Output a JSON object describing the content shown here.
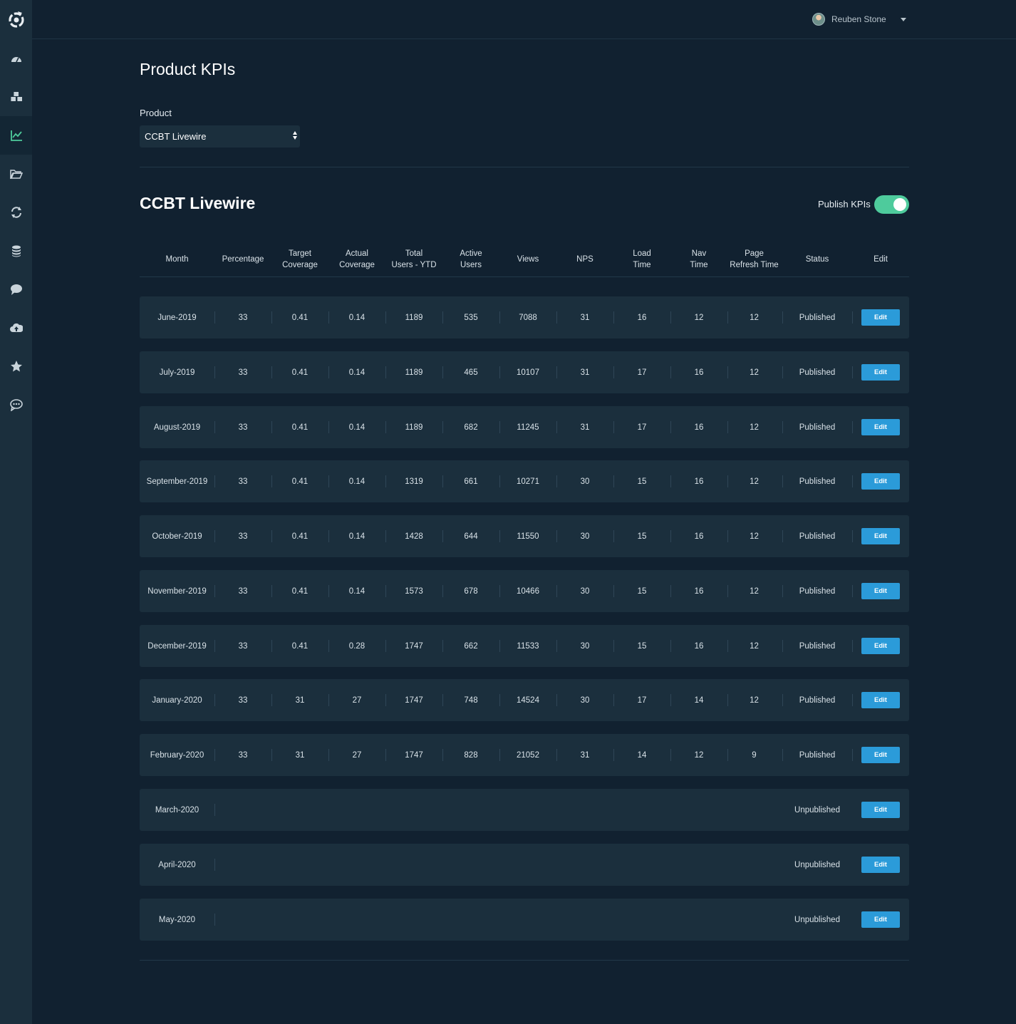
{
  "header": {
    "user_name": "Reuben Stone"
  },
  "sidebar": {
    "items": [
      {
        "icon": "dashboard-icon"
      },
      {
        "icon": "cubes-icon"
      },
      {
        "icon": "line-chart-icon",
        "active": true
      },
      {
        "icon": "folder-open-icon"
      },
      {
        "icon": "refresh-icon"
      },
      {
        "icon": "database-icon"
      },
      {
        "icon": "comment-icon"
      },
      {
        "icon": "cloud-upload-icon"
      },
      {
        "icon": "star-icon"
      },
      {
        "icon": "chat-dots-icon"
      }
    ]
  },
  "page": {
    "title": "Product KPIs",
    "product_label": "Product",
    "product_value": "CCBT Livewire"
  },
  "section": {
    "title": "CCBT Livewire",
    "publish_label": "Publish KPIs",
    "publish_on": true
  },
  "colors": {
    "accent_green": "#4ecb9c",
    "edit_blue": "#2b9bd9",
    "background": "#112130",
    "row": "#1b2f3d"
  },
  "table": {
    "columns": [
      [
        "Month"
      ],
      [
        "Percentage"
      ],
      [
        "Target",
        "Coverage"
      ],
      [
        "Actual",
        "Coverage"
      ],
      [
        "Total",
        "Users - YTD"
      ],
      [
        "Active",
        "Users"
      ],
      [
        "Views"
      ],
      [
        "NPS"
      ],
      [
        "Load",
        "Time"
      ],
      [
        "Nav",
        "Time"
      ],
      [
        "Page",
        "Refresh Time"
      ],
      [
        "Status"
      ],
      [
        "Edit"
      ]
    ],
    "edit_label": "Edit",
    "rows": [
      {
        "month": "June-2019",
        "values": [
          "33",
          "0.41",
          "0.14",
          "1189",
          "535",
          "7088",
          "31",
          "16",
          "12",
          "12"
        ],
        "status": "Published"
      },
      {
        "month": "July-2019",
        "values": [
          "33",
          "0.41",
          "0.14",
          "1189",
          "465",
          "10107",
          "31",
          "17",
          "16",
          "12"
        ],
        "status": "Published"
      },
      {
        "month": "August-2019",
        "values": [
          "33",
          "0.41",
          "0.14",
          "1189",
          "682",
          "11245",
          "31",
          "17",
          "16",
          "12"
        ],
        "status": "Published"
      },
      {
        "month": "September-2019",
        "values": [
          "33",
          "0.41",
          "0.14",
          "1319",
          "661",
          "10271",
          "30",
          "15",
          "16",
          "12"
        ],
        "status": "Published"
      },
      {
        "month": "October-2019",
        "values": [
          "33",
          "0.41",
          "0.14",
          "1428",
          "644",
          "11550",
          "30",
          "15",
          "16",
          "12"
        ],
        "status": "Published"
      },
      {
        "month": "November-2019",
        "values": [
          "33",
          "0.41",
          "0.14",
          "1573",
          "678",
          "10466",
          "30",
          "15",
          "16",
          "12"
        ],
        "status": "Published"
      },
      {
        "month": "December-2019",
        "values": [
          "33",
          "0.41",
          "0.28",
          "1747",
          "662",
          "11533",
          "30",
          "15",
          "16",
          "12"
        ],
        "status": "Published"
      },
      {
        "month": "January-2020",
        "values": [
          "33",
          "31",
          "27",
          "1747",
          "748",
          "14524",
          "30",
          "17",
          "14",
          "12"
        ],
        "status": "Published"
      },
      {
        "month": "February-2020",
        "values": [
          "33",
          "31",
          "27",
          "1747",
          "828",
          "21052",
          "31",
          "14",
          "12",
          "9"
        ],
        "status": "Published"
      },
      {
        "month": "March-2020",
        "values": [],
        "status": "Unpublished"
      },
      {
        "month": "April-2020",
        "values": [],
        "status": "Unpublished"
      },
      {
        "month": "May-2020",
        "values": [],
        "status": "Unpublished"
      }
    ]
  }
}
